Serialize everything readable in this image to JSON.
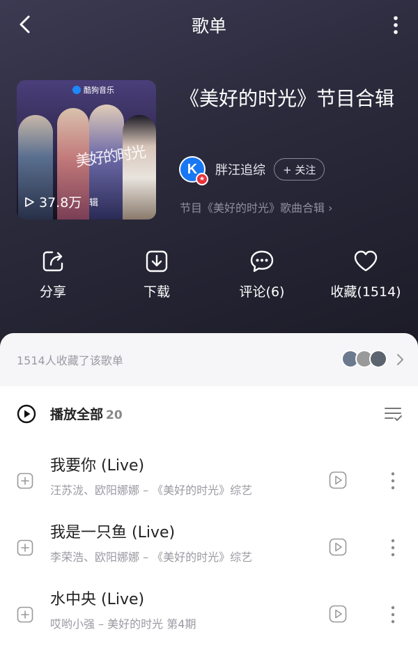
{
  "header": {
    "title": "歌单"
  },
  "cover": {
    "brand": "酷狗音乐",
    "art_text": "美好的时光",
    "play_count": "37.8万",
    "tag": "辑"
  },
  "playlist": {
    "name": "《美好的时光》节目合辑",
    "owner": "胖汪追综",
    "follow_label": "+ 关注",
    "description": "节目《美好的时光》歌曲合辑 ›"
  },
  "actions": [
    {
      "label": "分享",
      "icon": "share-icon"
    },
    {
      "label": "下载",
      "icon": "download-icon"
    },
    {
      "label": "评论(6)",
      "icon": "comment-icon"
    },
    {
      "label": "收藏(1514)",
      "icon": "heart-icon"
    }
  ],
  "collect": {
    "text": "1514人收藏了该歌单"
  },
  "play_all": {
    "label": "播放全部",
    "count": "20"
  },
  "songs": [
    {
      "title": "我要你 (Live)",
      "meta": "汪苏泷、欧阳娜娜 – 《美好的时光》综艺"
    },
    {
      "title": "我是一只鱼 (Live)",
      "meta": "李荣浩、欧阳娜娜 – 《美好的时光》综艺"
    },
    {
      "title": "水中央 (Live)",
      "meta": "哎哟小强 – 美好的时光 第4期"
    }
  ],
  "colors": {
    "hero_top": "#3b3a52",
    "hero_bottom": "#1c1b27",
    "badge_blue": "#1877f2",
    "badge_red": "#e8323c"
  }
}
